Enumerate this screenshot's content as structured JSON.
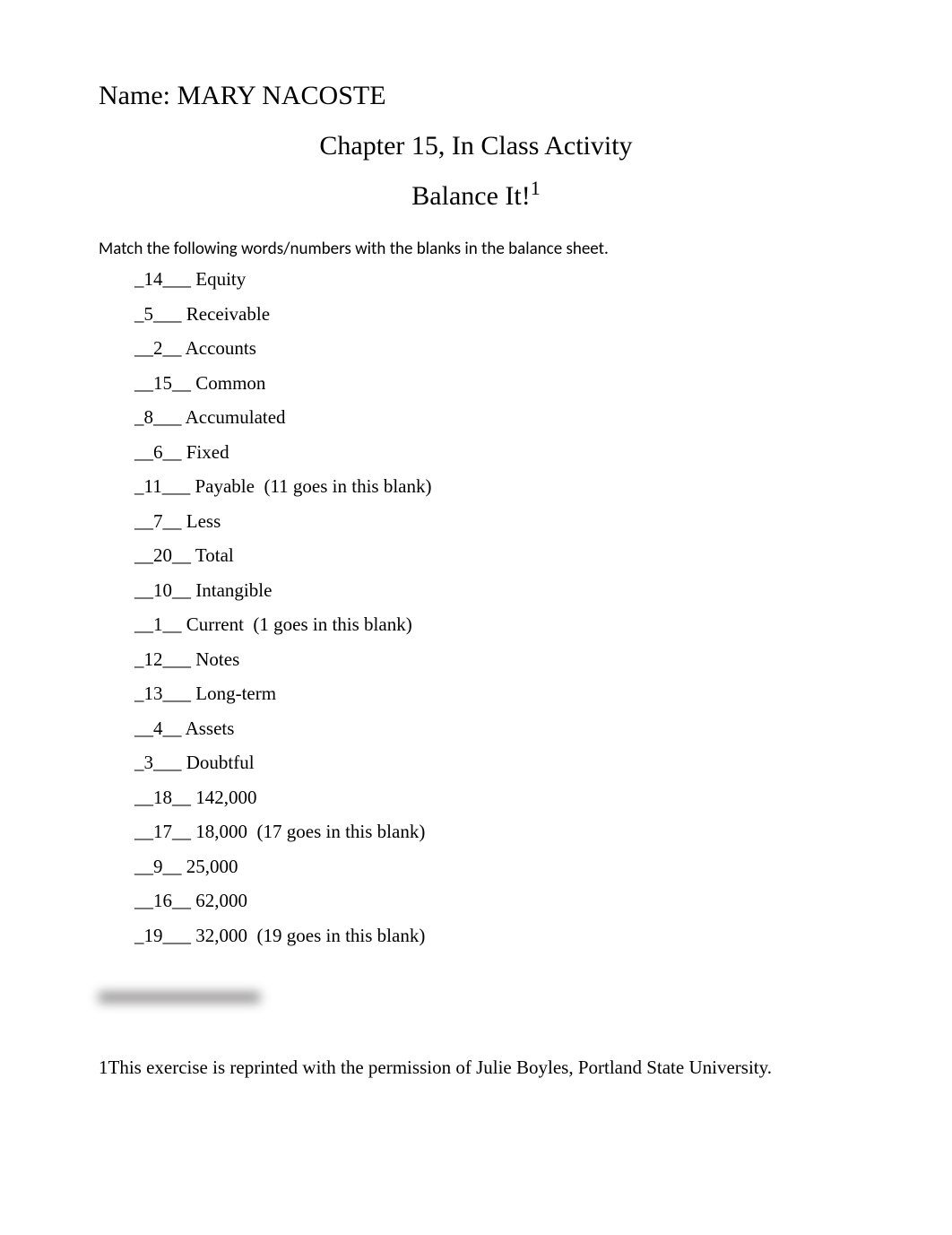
{
  "name_label": "Name:",
  "name_value": "MARY NACOSTE",
  "chapter_title": "Chapter 15, In Class Activity",
  "subtitle": "Balance It!",
  "superscript": "1",
  "instructions": "Match the following words/numbers with the blanks in the balance sheet.",
  "items": [
    "_14___ Equity",
    "_5___ Receivable",
    "__2__ Accounts",
    "__15__ Common",
    "_8___ Accumulated",
    "__6__ Fixed",
    "_11___ Payable  (11 goes in this blank)",
    "__7__ Less",
    "__20__ Total",
    "__10__ Intangible",
    "__1__ Current  (1 goes in this blank)",
    "_12___ Notes",
    "_13___ Long-term",
    "__4__ Assets",
    "_3___ Doubtful",
    "__18__ 142,000",
    "__17__ 18,000  (17 goes in this blank)",
    "__9__ 25,000",
    "__16__ 62,000",
    "_19___ 32,000  (19 goes in this blank)"
  ],
  "footnote": "1This exercise is reprinted with the permission of Julie Boyles, Portland State University."
}
